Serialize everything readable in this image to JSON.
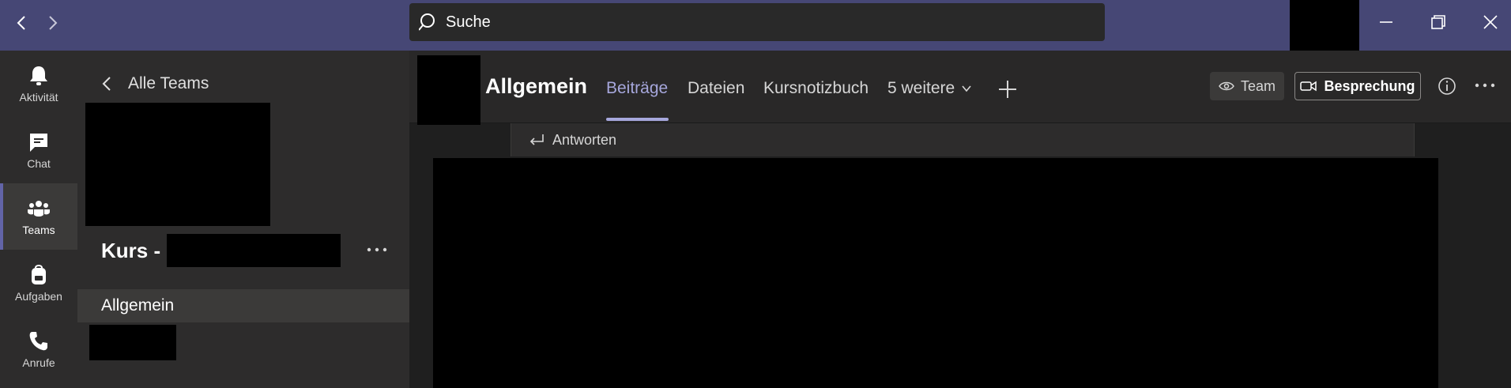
{
  "search": {
    "placeholder": "Suche"
  },
  "rail": {
    "items": [
      {
        "label": "Aktivität",
        "icon": "bell-icon",
        "active": false
      },
      {
        "label": "Chat",
        "icon": "chat-icon",
        "active": false
      },
      {
        "label": "Teams",
        "icon": "teams-icon",
        "active": true
      },
      {
        "label": "Aufgaben",
        "icon": "backpack-icon",
        "active": false
      },
      {
        "label": "Anrufe",
        "icon": "phone-icon",
        "active": false
      }
    ]
  },
  "team_panel": {
    "back_label": "Alle Teams",
    "team_name_prefix": "Kurs -",
    "channels": [
      {
        "label": "Allgemein",
        "selected": true
      }
    ]
  },
  "header": {
    "channel_title": "Allgemein",
    "tabs": [
      {
        "label": "Beiträge",
        "active": true
      },
      {
        "label": "Dateien",
        "active": false
      },
      {
        "label": "Kursnotizbuch",
        "active": false
      }
    ],
    "more_tabs_label": "5 weitere",
    "team_button": "Team",
    "meeting_button": "Besprechung"
  },
  "reply": {
    "label": "Antworten"
  },
  "colors": {
    "titlebar": "#464775",
    "accent": "#a6a7dc",
    "rail_bg": "#2d2c2c",
    "main_bg": "#1f1f1f"
  }
}
